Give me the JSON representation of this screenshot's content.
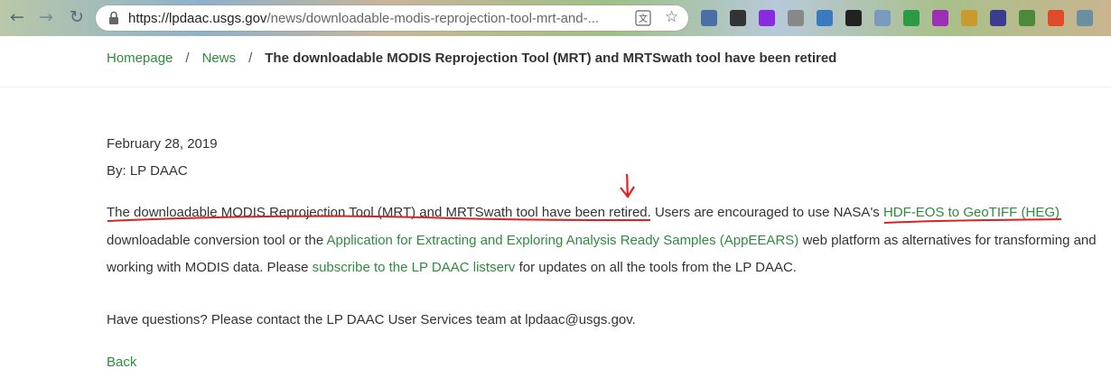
{
  "browser": {
    "url_host": "https://lpdaac.usgs.gov",
    "url_path": "/news/downloadable-modis-reprojection-tool-mrt-and-...",
    "icons": [
      "back-arrow-icon",
      "forward-arrow-icon",
      "reload-icon",
      "lock-icon",
      "translate-icon",
      "star-icon"
    ],
    "extensions": [
      "#4a6fa5",
      "#333333",
      "#8a2be2",
      "#888888",
      "#3a7abf",
      "#222222",
      "#7a9abf",
      "#2c9a44",
      "#9b2fb5",
      "#c99a2e",
      "#3b3b8f",
      "#4a8a3a",
      "#e04a2a",
      "#6a8fa0"
    ]
  },
  "breadcrumb": {
    "home": "Homepage",
    "separator": "/",
    "news": "News",
    "current": "The downloadable MODIS Reprojection Tool (MRT) and MRTSwath tool have been retired"
  },
  "article": {
    "date": "February 28, 2019",
    "author": "By: LP DAAC",
    "p1": "The downloadable MODIS Reprojection Tool (MRT) and MRTSwath tool have been retired",
    "p2": ". Users are encouraged to use NASA's ",
    "link_heg": "HDF-EOS to GeoTIFF (HEG)",
    "p3": " downloadable conversion tool or the ",
    "link_appeears": "Application for Extracting and Exploring Analysis Ready Samples (AppEEARS)",
    "p4": " web platform as alternatives for transforming and working with MODIS data. Please ",
    "link_listserv": "subscribe to the LP DAAC listserv",
    "p5": " for updates on all the tools from the LP DAAC.",
    "questions": "Have questions? Please contact the LP DAAC User Services team at lpdaac@usgs.gov.",
    "back": "Back"
  },
  "annotation_color": "#e02020"
}
